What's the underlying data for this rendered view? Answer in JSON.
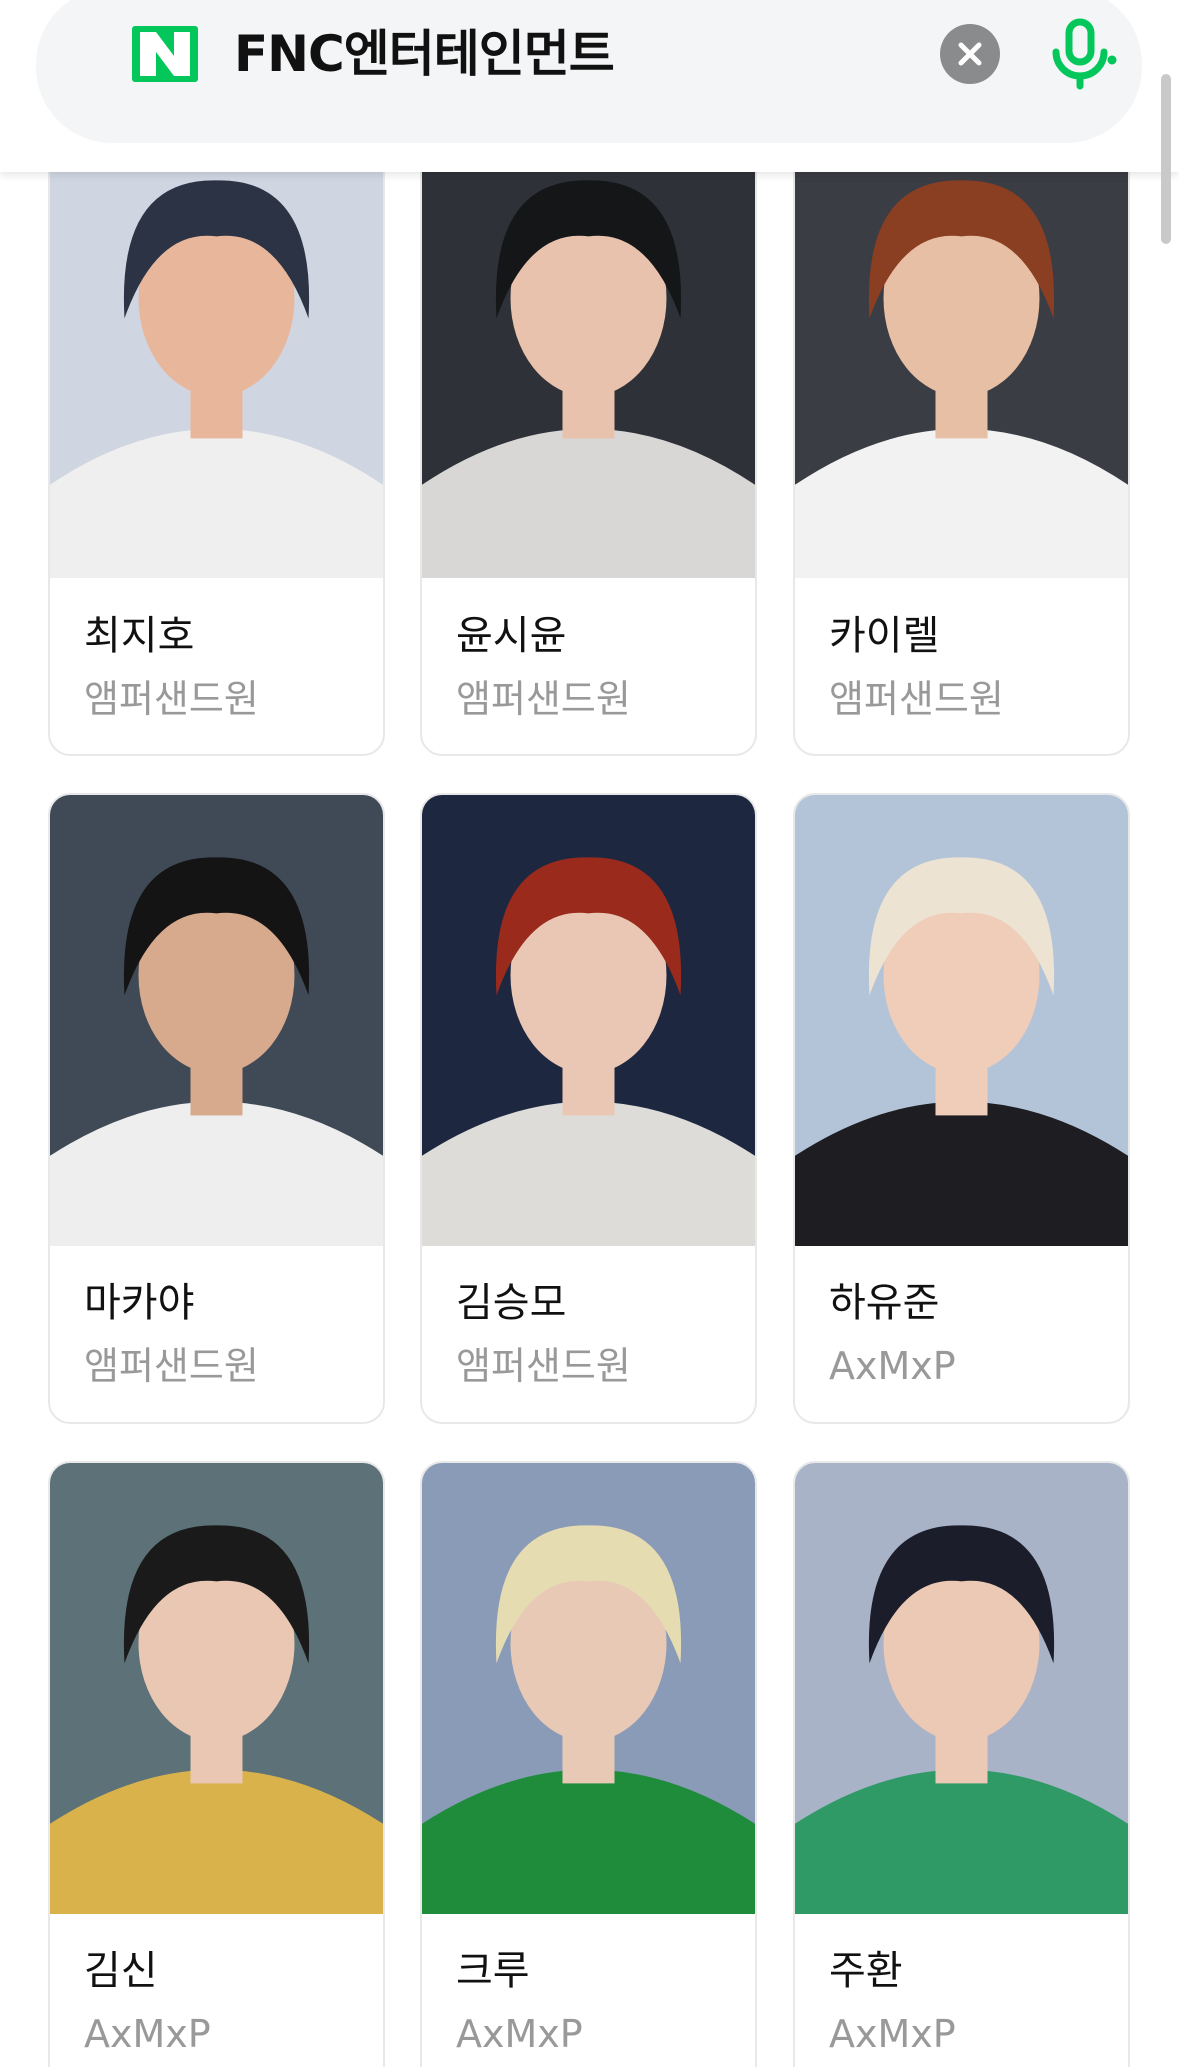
{
  "search": {
    "query": "FNC엔터테인먼트",
    "logo_letter": "N",
    "brand_color": "#03c75a"
  },
  "icons": {
    "clear": "close-icon",
    "voice": "microphone-icon"
  },
  "cards": [
    {
      "name": "최지호",
      "group": "앰퍼샌드원",
      "photo_colors": [
        "#cfd6e2",
        "#f0efef",
        "#e8b79b",
        "#2b3344"
      ]
    },
    {
      "name": "윤시윤",
      "group": "앰퍼샌드원",
      "photo_colors": [
        "#2e3238",
        "#d9d7d6",
        "#e8c2ad",
        "#151618"
      ]
    },
    {
      "name": "카이렐",
      "group": "앰퍼샌드원",
      "photo_colors": [
        "#3b3d44",
        "#f2f2f2",
        "#e7bfa4",
        "#8a3f22"
      ]
    },
    {
      "name": "마카야",
      "group": "앰퍼샌드원",
      "photo_colors": [
        "#3f4a56",
        "#eeeeee",
        "#d7a98d",
        "#141414"
      ]
    },
    {
      "name": "김승모",
      "group": "앰퍼샌드원",
      "photo_colors": [
        "#1d2740",
        "#dedcd8",
        "#eac7b4",
        "#9a2a1c"
      ]
    },
    {
      "name": "하유준",
      "group": "AxMxP",
      "photo_colors": [
        "#b4c4d8",
        "#1e1e22",
        "#efcdb8",
        "#ece3d2"
      ]
    },
    {
      "name": "김신",
      "group": "AxMxP",
      "photo_colors": [
        "#5c7278",
        "#d9b24c",
        "#e9c7b3",
        "#1a1a1a"
      ]
    },
    {
      "name": "크루",
      "group": "AxMxP",
      "photo_colors": [
        "#8a9bb8",
        "#1f8c3c",
        "#e8c9b6",
        "#e6dcb2"
      ]
    },
    {
      "name": "주환",
      "group": "AxMxP",
      "photo_colors": [
        "#a8b3c8",
        "#2f9a66",
        "#ecc9b4",
        "#1b1d2a"
      ]
    }
  ]
}
